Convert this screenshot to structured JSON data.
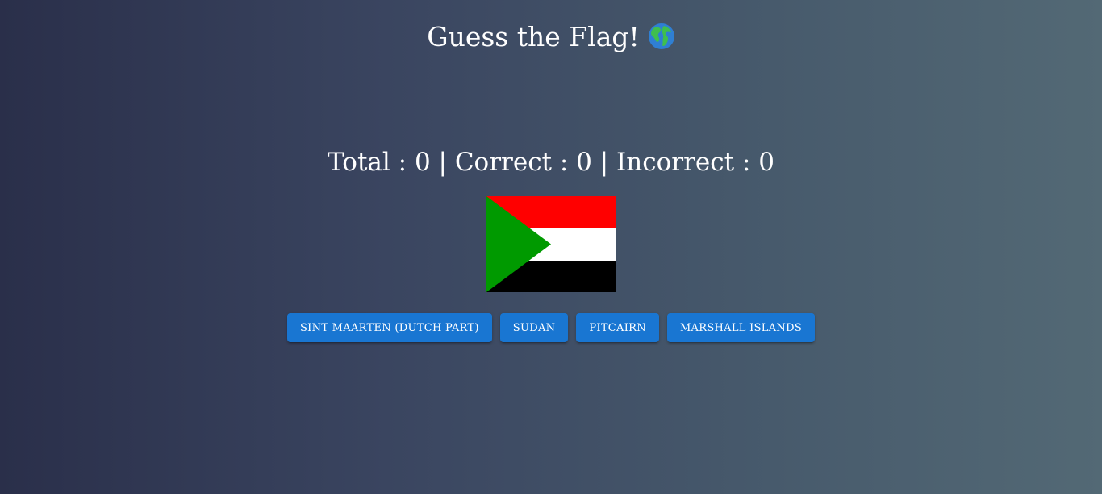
{
  "header": {
    "title": "Guess the Flag!",
    "icon": "globe-americas-icon"
  },
  "score": {
    "text": "Total : 0 | Correct : 0 | Incorrect : 0",
    "total": 0,
    "correct": 0,
    "incorrect": 0
  },
  "flag": {
    "colors": {
      "top": "#ff0000",
      "middle": "#ffffff",
      "bottom": "#000000",
      "triangle": "#009a00"
    }
  },
  "options": [
    {
      "label": "Sint Maarten (Dutch part)"
    },
    {
      "label": "Sudan"
    },
    {
      "label": "Pitcairn"
    },
    {
      "label": "Marshall Islands"
    }
  ],
  "colors": {
    "button_bg": "#1976d2",
    "text": "#ffffff"
  }
}
